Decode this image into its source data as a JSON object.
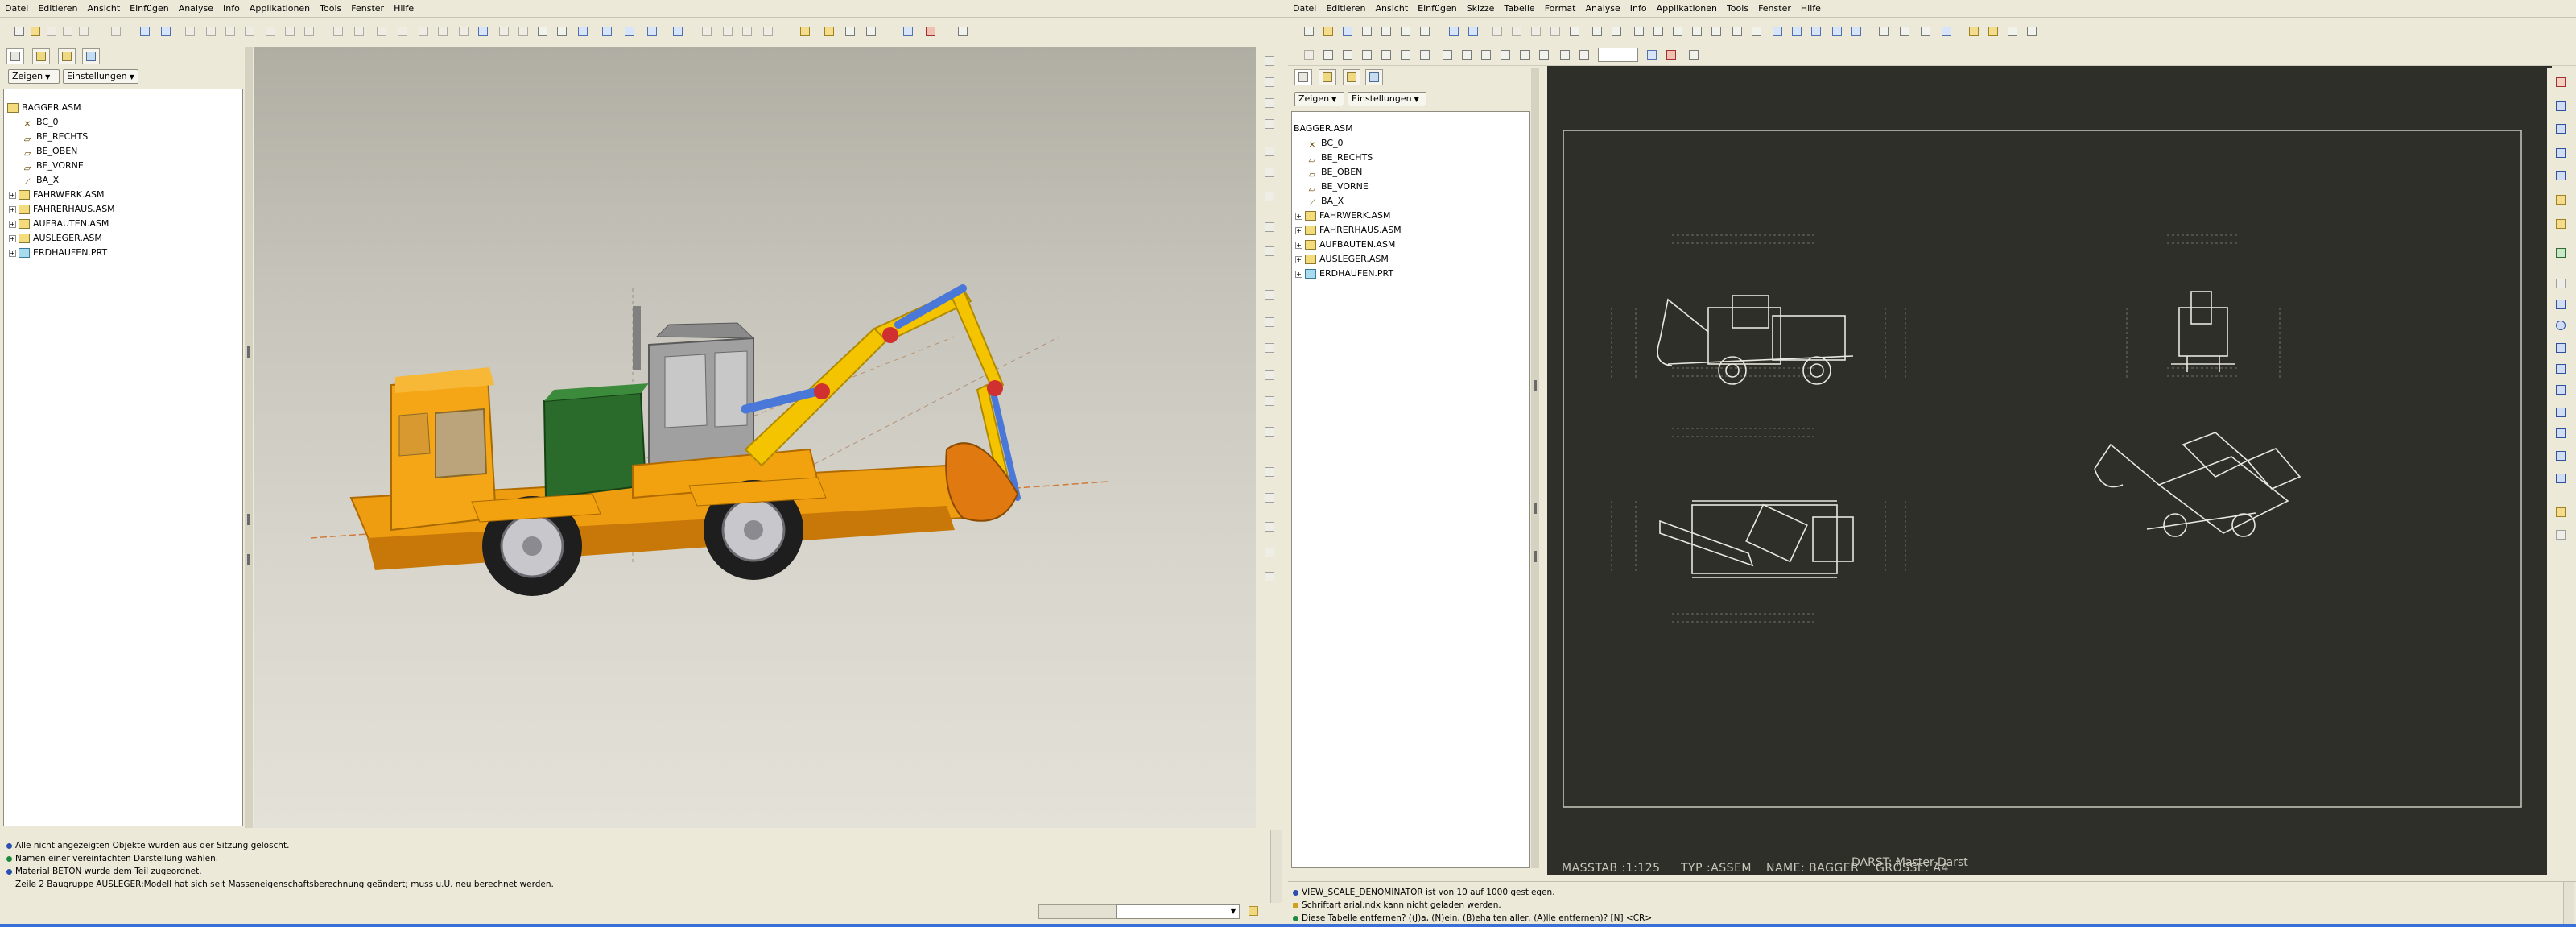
{
  "left_window": {
    "menu": [
      "Datei",
      "Editieren",
      "Ansicht",
      "Einfügen",
      "Analyse",
      "Info",
      "Applikationen",
      "Tools",
      "Fenster",
      "Hilfe"
    ],
    "show_button": "Zeigen",
    "settings_button": "Einstellungen",
    "tree": {
      "root": "BAGGER.ASM",
      "items": [
        {
          "label": "BC_0",
          "icon": "csys-icon",
          "expandable": false
        },
        {
          "label": "BE_RECHTS",
          "icon": "datum-plane-icon",
          "expandable": false
        },
        {
          "label": "BE_OBEN",
          "icon": "datum-plane-icon",
          "expandable": false
        },
        {
          "label": "BE_VORNE",
          "icon": "datum-plane-icon",
          "expandable": false
        },
        {
          "label": "BA_X",
          "icon": "datum-axis-icon",
          "expandable": false
        },
        {
          "label": "FAHRWERK.ASM",
          "icon": "assembly-icon",
          "expandable": true
        },
        {
          "label": "FAHRERHAUS.ASM",
          "icon": "assembly-icon",
          "expandable": true
        },
        {
          "label": "AUFBAUTEN.ASM",
          "icon": "assembly-icon",
          "expandable": true
        },
        {
          "label": "AUSLEGER.ASM",
          "icon": "assembly-icon",
          "expandable": true
        },
        {
          "label": "ERDHAUFEN.PRT",
          "icon": "part-icon",
          "expandable": true
        }
      ]
    },
    "messages": [
      {
        "text": "Alle nicht angezeigten Objekte wurden aus der Sitzung gelöscht.",
        "bullet": "blue"
      },
      {
        "text": "Namen einer vereinfachten Darstellung wählen.",
        "bullet": "green"
      },
      {
        "text": "Material BETON wurde dem Teil zugeordnet.",
        "bullet": "blue"
      },
      {
        "text": "Zeile 2 Baugruppe AUSLEGER:Modell hat sich seit Masseneigenschaftsberechnung geändert; muss u.U. neu berechnet werden.",
        "bullet": "none"
      }
    ]
  },
  "right_window": {
    "menu": [
      "Datei",
      "Editieren",
      "Ansicht",
      "Einfügen",
      "Skizze",
      "Tabelle",
      "Format",
      "Analyse",
      "Info",
      "Applikationen",
      "Tools",
      "Fenster",
      "Hilfe"
    ],
    "show_button": "Zeigen",
    "settings_button": "Einstellungen",
    "tree": {
      "root": "BAGGER.ASM",
      "items": [
        {
          "label": "BC_0",
          "icon": "csys-icon",
          "expandable": false
        },
        {
          "label": "BE_RECHTS",
          "icon": "datum-plane-icon",
          "expandable": false
        },
        {
          "label": "BE_OBEN",
          "icon": "datum-plane-icon",
          "expandable": false
        },
        {
          "label": "BE_VORNE",
          "icon": "datum-plane-icon",
          "expandable": false
        },
        {
          "label": "BA_X",
          "icon": "datum-axis-icon",
          "expandable": false
        },
        {
          "label": "FAHRWERK.ASM",
          "icon": "assembly-icon",
          "expandable": true
        },
        {
          "label": "FAHRERHAUS.ASM",
          "icon": "assembly-icon",
          "expandable": true
        },
        {
          "label": "AUFBAUTEN.ASM",
          "icon": "assembly-icon",
          "expandable": true
        },
        {
          "label": "AUSLEGER.ASM",
          "icon": "assembly-icon",
          "expandable": true
        },
        {
          "label": "ERDHAUFEN.PRT",
          "icon": "part-icon",
          "expandable": true
        }
      ]
    },
    "drawing": {
      "darst": "DARST: Master-Darst",
      "massstab": "MASSTAB :1:125",
      "typ": "TYP :ASSEM",
      "name": "NAME: BAGGER",
      "groesse": "GRÖSSE: A4"
    },
    "messages": [
      {
        "text": "VIEW_SCALE_DENOMINATOR ist von 10 auf 1000 gestiegen.",
        "bullet": "blue"
      },
      {
        "text": "Schriftart arial.ndx kann nicht geladen werden.",
        "bullet": "warn"
      },
      {
        "text": "Diese Tabelle entfernen? ((J)a, (N)ein, (B)ehalten aller, (A)lle entfernen)? [N]  <CR>",
        "bullet": "green"
      }
    ]
  },
  "colors": {
    "chrome": "#ece9d8",
    "drawing_bg": "#2f2f2a",
    "excavator_orange": "#f2a20e",
    "excavator_yellow": "#f5c400",
    "engine_green": "#2a6a2a",
    "cab_grey": "#9a9a9a",
    "cylinder_blue": "#4a78d8",
    "joint_red": "#d03030"
  }
}
